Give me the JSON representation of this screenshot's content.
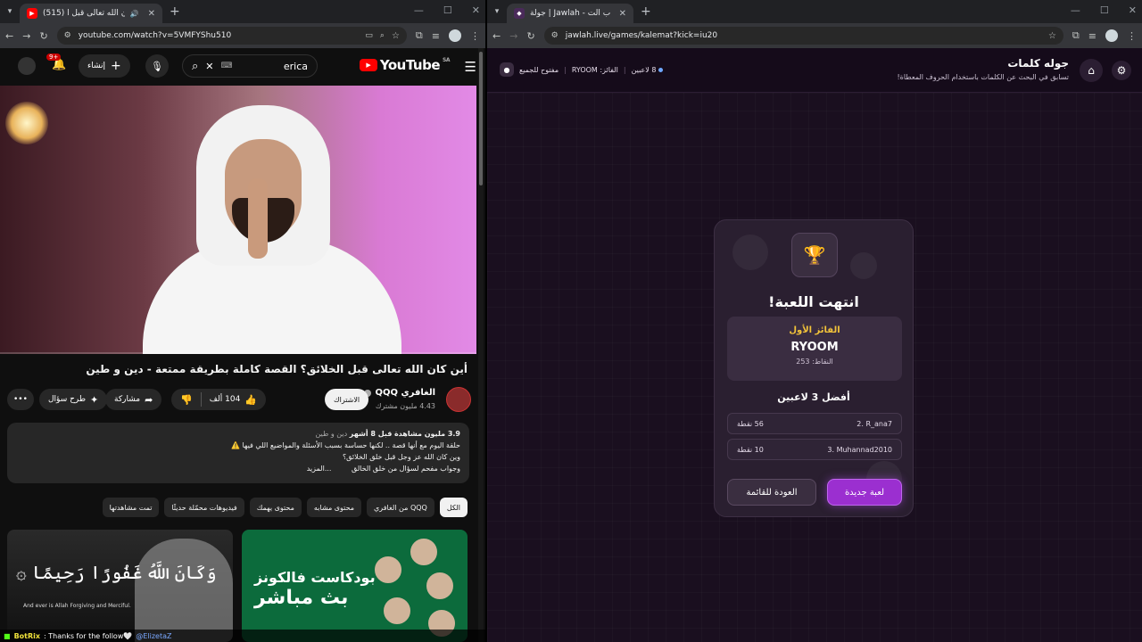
{
  "left_window": {
    "tab_title": "(515) أين كان الله تعالى قبل ا...",
    "url": "youtube.com/watch?v=5VMFYShu510",
    "youtube": {
      "logo_text": "YouTube",
      "region": "SA",
      "search_value": "erica",
      "create_label": "إنشاء",
      "notifications_badge": "9+",
      "video": {
        "title": "أين كان الله تعالى قبل الخلائق؟ القصة كاملة بطريقة ممتعة - دين و طين",
        "channel_name": "الغافري QQQ",
        "subscribers": "4.43 مليون مشترك",
        "subscribe_label": "الاشتراك",
        "likes": "104 ألف",
        "share_label": "مشاركة",
        "ask_label": "طرح سؤال",
        "more_label": "•••"
      },
      "description": {
        "views": "3.9 مليون مشاهدة",
        "age": "قبل 8 أشهر",
        "tags": "دين و طين",
        "line1": "حلقة اليوم مع أنها قصة .. لكنها حساسة بسبب الأسئلة والمواضيع اللي فيها ⚠️",
        "line2": "وين كان الله عز وجل قبل خلق الخلائق؟",
        "line3": "وجواب مفحم لسؤال من خلق الخالق",
        "more": "...المزيد"
      },
      "chips": [
        "الكل",
        "من الغافري QQQ",
        "محتوى مشابه",
        "محتوى يهمك",
        "فيديوهات محمّلة حديثًا",
        "تمت مشاهدتها"
      ],
      "thumb1": {
        "arabic": "وَكَانَ اللَّهُ غَفُورًا رَحِيمًا ۞",
        "english": "And ever is Allah Forgiving and Merciful."
      },
      "thumb2": {
        "label": "بودكاست فالكونز",
        "live": "بث مباشر"
      }
    },
    "chat": {
      "user": "BotRix",
      "message": ": Thanks for the follow🤍",
      "mention": "@ElizetaZ"
    }
  },
  "right_window": {
    "tab_title": "جولة | Jawlah - منصة الألعاب الت...",
    "url": "jawlah.live/games/kalemat?kick=iu20",
    "header": {
      "title": "جوله كلمات",
      "subtitle": "تسابق في البحث عن الكلمات باستخدام الحروف المعطاة!",
      "players": "8 لاعبين",
      "winner_label": "الفائز: RYOOM",
      "open_label": "مفتوح للجميع"
    },
    "result": {
      "title": "انتهت اللعبة!",
      "first_label": "الفائز الأول",
      "winner_name": "RYOOM",
      "winner_points": "النقاط: 253",
      "top3_label": "أفضل 3 لاعبين",
      "ranks": [
        {
          "name": "2. R_ana7",
          "points": "56 نقطة"
        },
        {
          "name": "3. Muhannad2010",
          "points": "10 نقطة"
        }
      ],
      "back_label": "العودة للقائمة",
      "new_label": "لعبة جديدة"
    }
  }
}
